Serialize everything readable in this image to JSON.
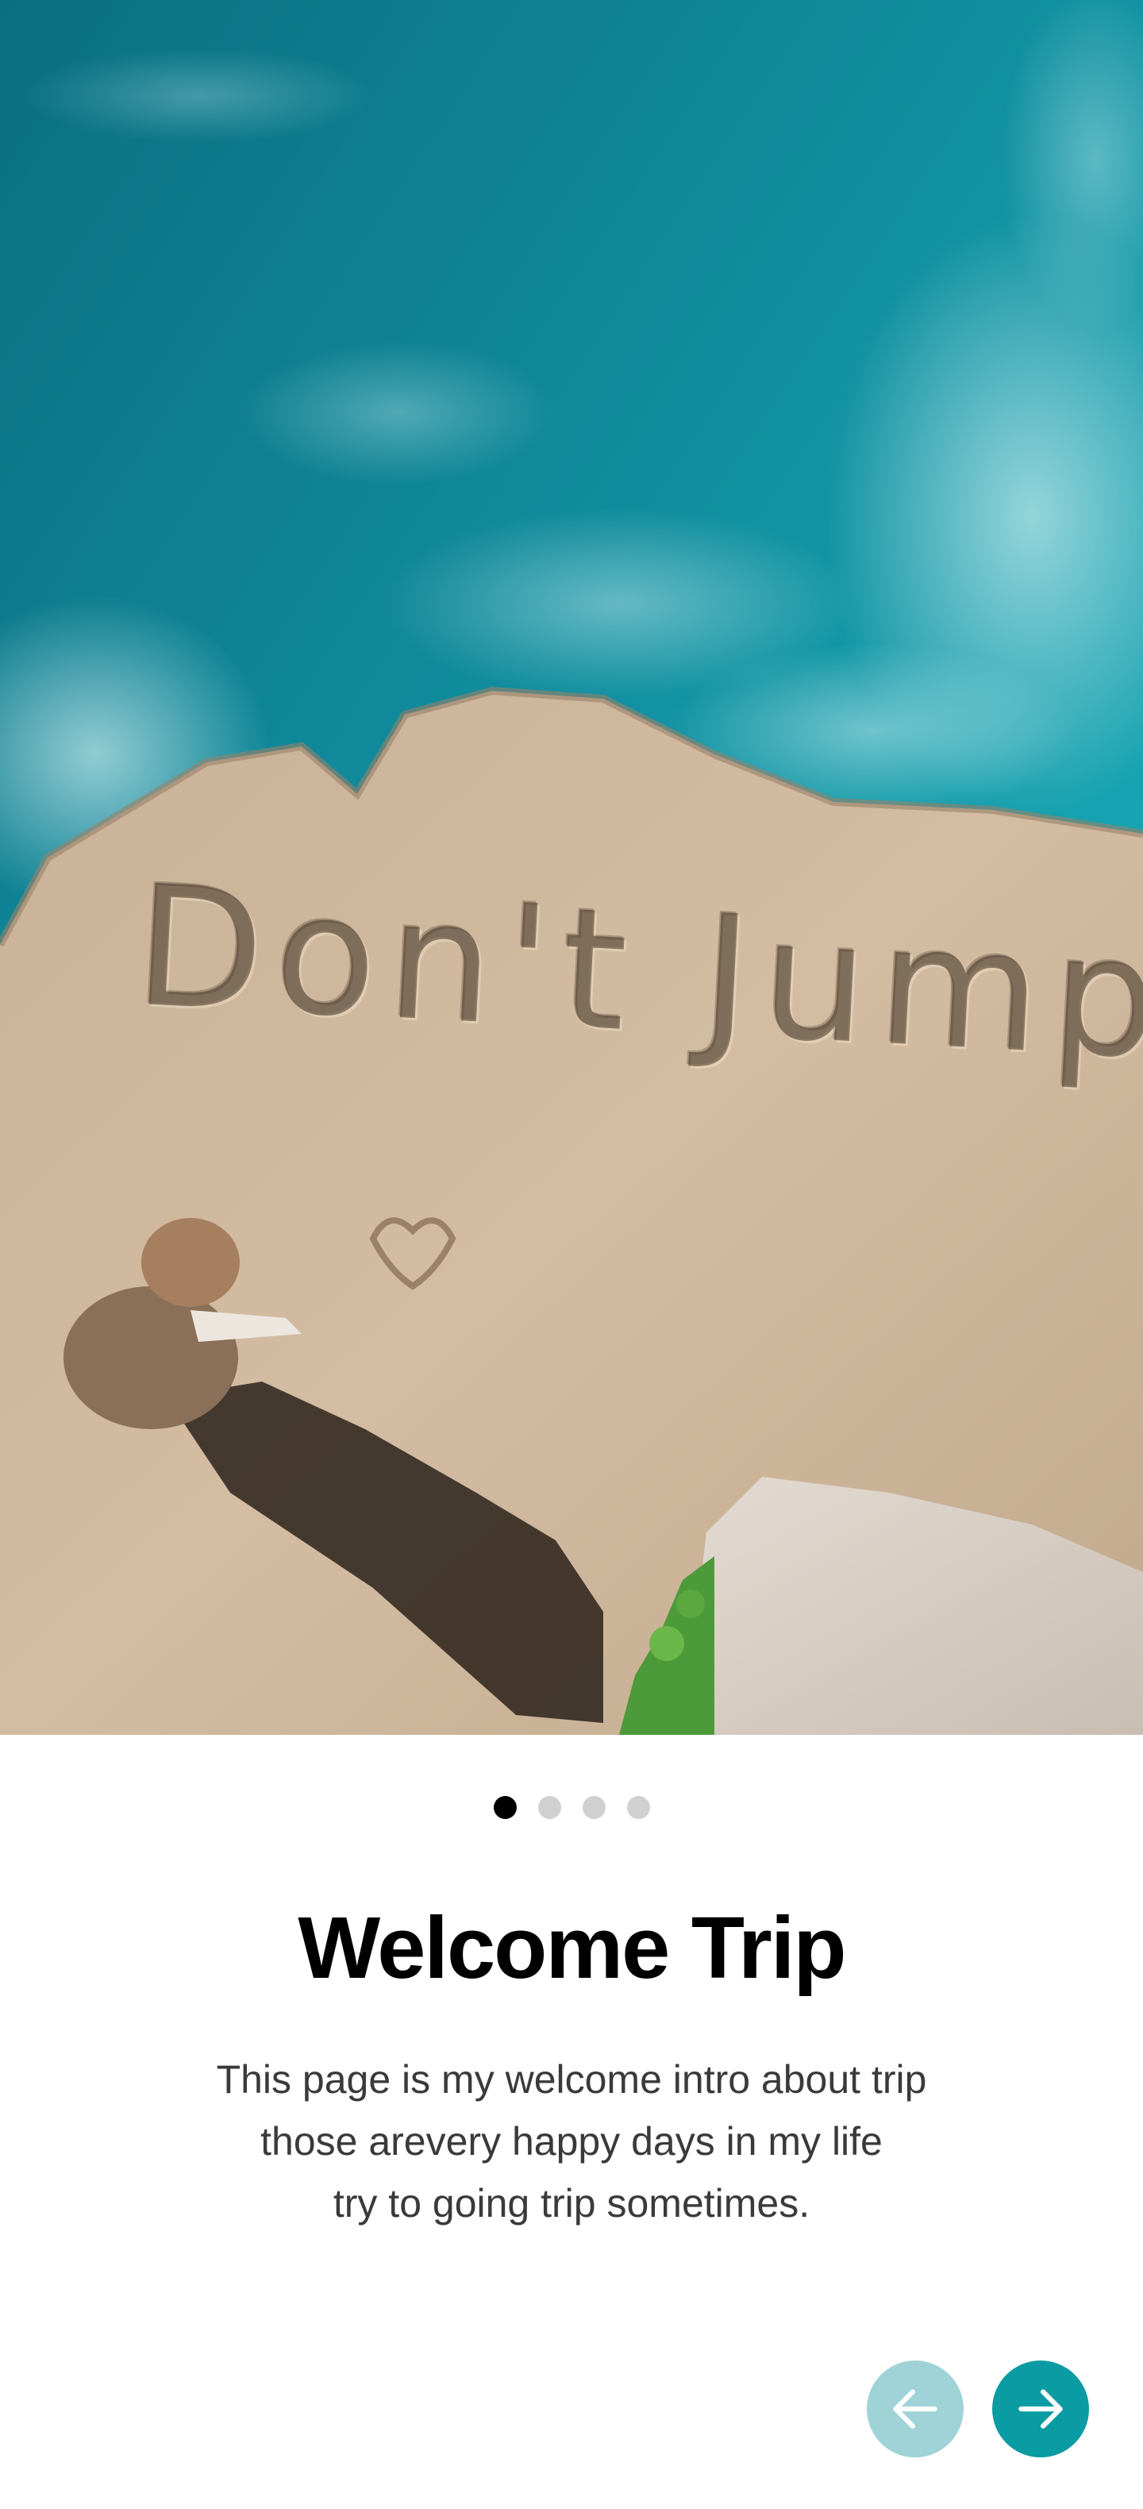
{
  "hero": {
    "cliff_writing": "Don't Jump"
  },
  "pagination": {
    "total": 4,
    "active_index": 0
  },
  "content": {
    "title": "Welcome Trip",
    "description_lines": [
      "This page is my welcome intro about trip",
      "those arevery happy days in my life",
      "try to going trip sometimes."
    ]
  },
  "navigation": {
    "prev_icon": "arrow-left-icon",
    "next_icon": "arrow-right-icon"
  },
  "colors": {
    "accent": "#0b9ba3",
    "accent_disabled": "#9fd3d7",
    "dot_active": "#000000",
    "dot_inactive": "#d0d0d0"
  }
}
